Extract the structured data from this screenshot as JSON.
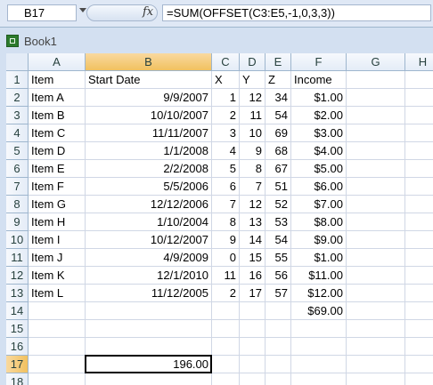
{
  "formula_bar": {
    "name_box": "B17",
    "fx_label": "fx",
    "formula": "=SUM(OFFSET(C3:E5,-1,0,3,3))"
  },
  "workbook": {
    "title": "Book1"
  },
  "sheet": {
    "columns": [
      "A",
      "B",
      "C",
      "D",
      "E",
      "F",
      "G",
      "H"
    ],
    "selected_column": "B",
    "selected_row": "17",
    "row_numbers": [
      "1",
      "2",
      "3",
      "4",
      "5",
      "6",
      "7",
      "8",
      "9",
      "10",
      "11",
      "12",
      "13",
      "14",
      "15",
      "16",
      "17",
      "18"
    ],
    "rows": [
      [
        "Item",
        "Start Date",
        "X",
        "Y",
        "Z",
        "Income",
        "",
        ""
      ],
      [
        "Item A",
        "9/9/2007",
        "1",
        "12",
        "34",
        "$1.00",
        "",
        ""
      ],
      [
        "Item B",
        "10/10/2007",
        "2",
        "11",
        "54",
        "$2.00",
        "",
        ""
      ],
      [
        "Item C",
        "11/11/2007",
        "3",
        "10",
        "69",
        "$3.00",
        "",
        ""
      ],
      [
        "Item D",
        "1/1/2008",
        "4",
        "9",
        "68",
        "$4.00",
        "",
        ""
      ],
      [
        "Item E",
        "2/2/2008",
        "5",
        "8",
        "67",
        "$5.00",
        "",
        ""
      ],
      [
        "Item F",
        "5/5/2006",
        "6",
        "7",
        "51",
        "$6.00",
        "",
        ""
      ],
      [
        "Item G",
        "12/12/2006",
        "7",
        "12",
        "52",
        "$7.00",
        "",
        ""
      ],
      [
        "Item H",
        "1/10/2004",
        "8",
        "13",
        "53",
        "$8.00",
        "",
        ""
      ],
      [
        "Item I",
        "10/12/2007",
        "9",
        "14",
        "54",
        "$9.00",
        "",
        ""
      ],
      [
        "Item J",
        "4/9/2009",
        "0",
        "15",
        "55",
        "$1.00",
        "",
        ""
      ],
      [
        "Item K",
        "12/1/2010",
        "11",
        "16",
        "56",
        "$11.00",
        "",
        ""
      ],
      [
        "Item L",
        "11/12/2005",
        "2",
        "17",
        "57",
        "$12.00",
        "",
        ""
      ],
      [
        "",
        "",
        "",
        "",
        "",
        "$69.00",
        "",
        ""
      ],
      [
        "",
        "",
        "",
        "",
        "",
        "",
        "",
        ""
      ],
      [
        "",
        "",
        "",
        "",
        "",
        "",
        "",
        ""
      ],
      [
        "",
        "196.00",
        "",
        "",
        "",
        "",
        "",
        ""
      ],
      [
        "",
        "",
        "",
        "",
        "",
        "",
        "",
        ""
      ]
    ],
    "alignment": [
      "l",
      "r",
      "r",
      "r",
      "r",
      "r",
      "l",
      "l"
    ],
    "header_row_alignment": [
      "l",
      "l",
      "l",
      "l",
      "l",
      "l",
      "l",
      "l"
    ]
  }
}
